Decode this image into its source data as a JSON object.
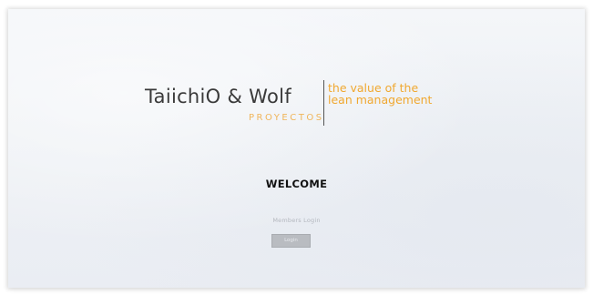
{
  "logo": {
    "brand_name": "TaiichiO & Wolf",
    "brand_sub": "PROYECTOS",
    "tagline_line1": "the value of the",
    "tagline_line2": "lean management"
  },
  "main": {
    "welcome": "WELCOME",
    "members_login": "Members Login",
    "login_button_label": "Login"
  },
  "colors": {
    "brand_text": "#3a3a3a",
    "accent_orange": "#f0a830",
    "button_bg": "#b9bcc1",
    "background": "#eef1f5"
  }
}
